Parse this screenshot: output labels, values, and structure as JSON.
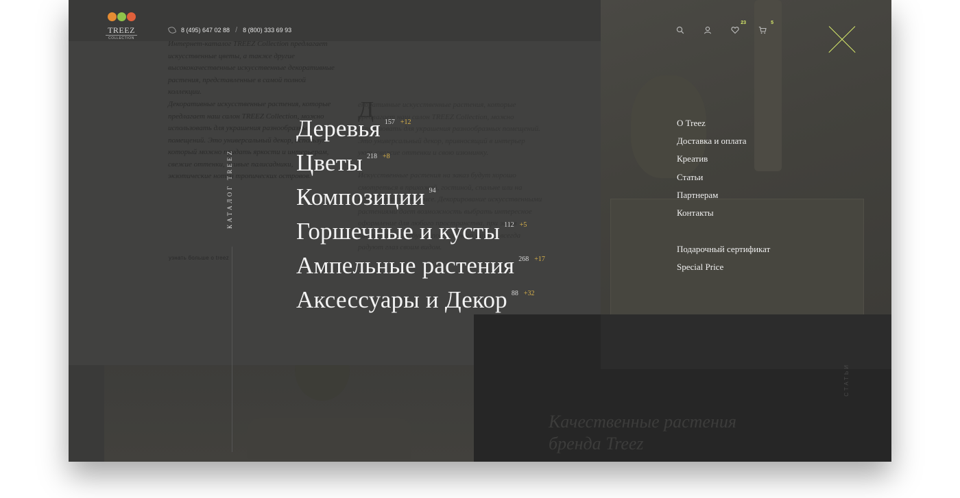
{
  "brand": {
    "name": "TREEZ",
    "sub": "COLLECTION",
    "colors": [
      "#e58c33",
      "#8fc44b",
      "#e0603b"
    ]
  },
  "header": {
    "phones": [
      "8 (495) 647 02 88",
      "8 (800) 333 69 93"
    ],
    "separator": "/",
    "icons": [
      "phone-icon",
      "search-icon",
      "user-icon",
      "heart-icon",
      "cart-icon",
      "close-icon"
    ],
    "favorites_count": "23",
    "cart_count": "5",
    "accent_color": "#d6e86a"
  },
  "catalog": {
    "label": "КАТАЛОГ TREEZ",
    "items": [
      {
        "label": "Деревья",
        "count": "157",
        "new": "+12"
      },
      {
        "label": "Цветы",
        "count": "218",
        "new": "+8"
      },
      {
        "label": "Композиции",
        "count": "94",
        "new": ""
      },
      {
        "label": "Горшечные и кусты",
        "count": "112",
        "new": "+5"
      },
      {
        "label": "Ампельные растения",
        "count": "268",
        "new": "+17"
      },
      {
        "label": "Аксессуары и Декор",
        "count": "88",
        "new": "+32"
      }
    ]
  },
  "links": {
    "primary": [
      "О Treez",
      "Доставка и оплата",
      "Креатив",
      "Статьи",
      "Партнерам",
      "Контакты"
    ],
    "secondary": [
      "Подарочный сертификат",
      "Special Price"
    ]
  },
  "background": {
    "para1": "Интернет-каталог TREEZ Collection предлагает искусственные цветы, а также другие высококачественные искусственные декоративные растения, представленные в самой полной коллекции.",
    "para2": "Декоративные искусственные растения, которые предлагает наш салон TREEZ Collection, можно использовать для украшения разнообразных помещений. Это универсальный декор, используя который можно придать яркости и интерьерам, свежие оттенки, живые палисадники, экзотические нотки тропических островов.",
    "drop_letter": "Д",
    "para3": "екоративные искусственные растения, которые предлагает наш салон TREEZ Collection, можно использовать для украшения разнообразных помещений. Это универсальный декор, привносящий в интерьер уют, свежие оттенки и свою изюминку.",
    "para4": "Искусственные растения на заказ будут хорошо смотреться в прихожей, гостиной, спальне или на кухне, а также в офисе. Декорирование искусственными растениями дает возможность выбрать интересное оформление для любого пространства, при этом растения не требуют постоянного ухода и всегда радуют глаз своим видом.",
    "more_link": "узнать больше о treez",
    "heading": "Качественные растения бренда Treez",
    "side_label": "СТАТЬИ"
  }
}
